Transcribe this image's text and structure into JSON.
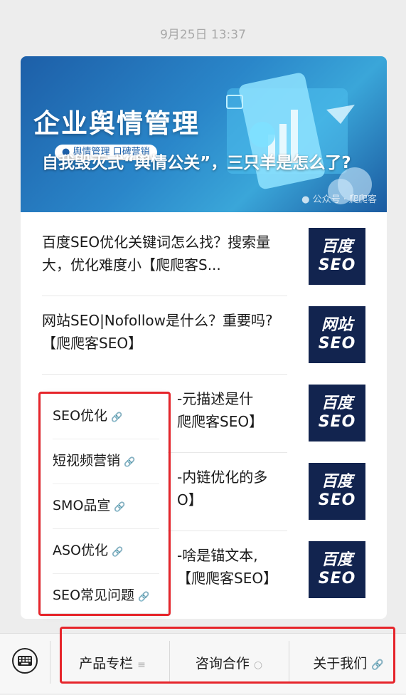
{
  "timestamp": "9月25日 13:37",
  "hero": {
    "brand": "企业舆情管理",
    "tag": "● 舆情管理  口碑营销",
    "title": "自我毁灭式“舆情公关”，三只羊是怎么了?",
    "source": "公众号 · 爬爬客"
  },
  "articles": [
    {
      "title": "百度SEO优化关键词怎么找？搜索量大，优化难度小【爬爬客S...",
      "thumb_top": "百度",
      "thumb_bottom": "SEO"
    },
    {
      "title": "网站SEO|Nofollow是什么？重要吗?【爬爬客SEO】",
      "thumb_top": "网站",
      "thumb_bottom": "SEO"
    },
    {
      "title": "-元描述是什",
      "title2": "爬爬客SEO】",
      "thumb_top": "百度",
      "thumb_bottom": "SEO"
    },
    {
      "title": "-内链优化的多",
      "title2": "O】",
      "thumb_top": "百度",
      "thumb_bottom": "SEO"
    },
    {
      "title": "-啥是锚文本,",
      "title2": "【爬爬客SEO】",
      "thumb_top": "百度",
      "thumb_bottom": "SEO"
    }
  ],
  "popup_menu": {
    "items": [
      "SEO优化",
      "短视频营销",
      "SMO品宣",
      "ASO优化",
      "SEO常见问题"
    ],
    "link_icon": "link-icon"
  },
  "bottom_menu": {
    "items": [
      {
        "label": "产品专栏",
        "icon": "list-icon"
      },
      {
        "label": "咨询合作",
        "icon": "chat-icon"
      },
      {
        "label": "关于我们",
        "icon": "link-icon"
      }
    ]
  },
  "colors": {
    "highlight": "#e6252b",
    "thumb_bg": "#12244f",
    "hero_bg": "#1d5fa8"
  }
}
